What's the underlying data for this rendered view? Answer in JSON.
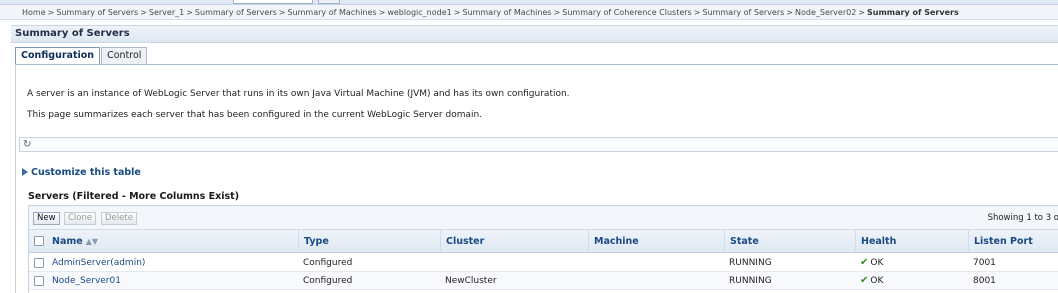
{
  "breadcrumb": {
    "items": [
      "Home",
      "Summary of Servers",
      "Server_1",
      "Summary of Servers",
      "Summary of Machines",
      "weblogic_node1",
      "Summary of Machines",
      "Summary of Coherence Clusters",
      "Summary of Servers",
      "Node_Server02"
    ],
    "separator": ">",
    "current": "Summary of Servers"
  },
  "page": {
    "title": "Summary of Servers"
  },
  "tabs": [
    {
      "label": "Configuration",
      "active": true
    },
    {
      "label": "Control",
      "active": false
    }
  ],
  "description": {
    "line1": "A server is an instance of WebLogic Server that runs in its own Java Virtual Machine (JVM) and has its own configuration.",
    "line2": "This page summarizes each server that has been configured in the current WebLogic Server domain."
  },
  "refresh": {
    "icon": "refresh-icon"
  },
  "customize": {
    "label": "Customize this table",
    "icon": "expand-triangle-icon"
  },
  "servers_table": {
    "title": "Servers (Filtered - More Columns Exist)",
    "toolbar": {
      "new_label": "New",
      "clone_label": "Clone",
      "delete_label": "Delete",
      "showing_text": "Showing 1 to 3 o"
    },
    "columns": {
      "name": "Name",
      "type": "Type",
      "cluster": "Cluster",
      "machine": "Machine",
      "state": "State",
      "health": "Health",
      "listen_port": "Listen Port"
    },
    "rows": [
      {
        "name": "AdminServer(admin)",
        "type": "Configured",
        "cluster": "",
        "machine": "",
        "state": "RUNNING",
        "health": "OK",
        "listen_port": "7001"
      },
      {
        "name": "Node_Server01",
        "type": "Configured",
        "cluster": "NewCluster",
        "machine": "",
        "state": "RUNNING",
        "health": "OK",
        "listen_port": "8001"
      }
    ]
  },
  "colors": {
    "link": "#1a4a84",
    "header_bg": "#dfe8f3",
    "ok_green": "#3a8a2a"
  }
}
